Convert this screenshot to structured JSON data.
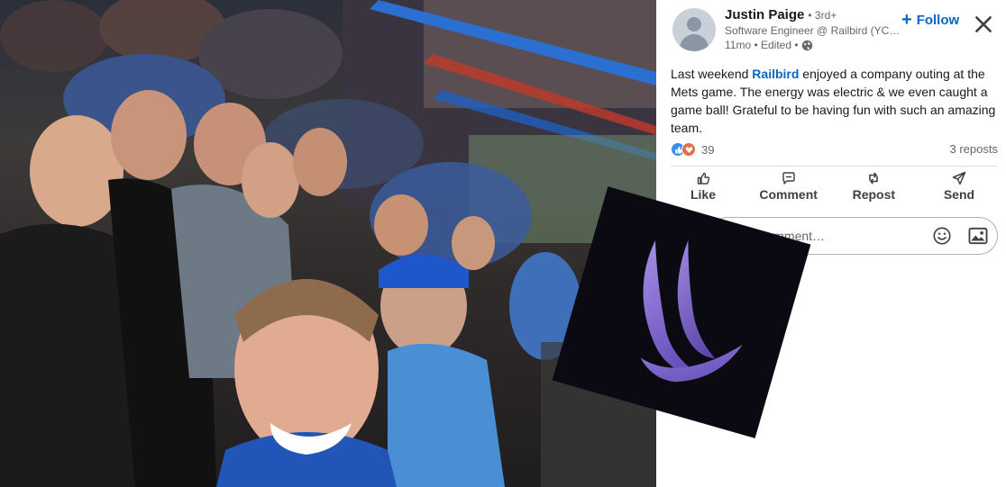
{
  "author": {
    "name": "Justin Paige",
    "degree": "• 3rd+",
    "headline": "Software Engineer @ Railbird (YC…",
    "meta": "11mo • Edited •"
  },
  "follow_label": "Follow",
  "post": {
    "text_before": "Last weekend ",
    "mention": "Railbird",
    "text_after": " enjoyed a company outing at the Mets game. The energy was electric & we even caught a game ball! Grateful to be having fun with such an amazing team."
  },
  "social": {
    "reaction_count": "39",
    "reposts": "3 reposts"
  },
  "actions": [
    {
      "label": "Like",
      "icon": "thumbs-up-icon"
    },
    {
      "label": "Comment",
      "icon": "comment-icon"
    },
    {
      "label": "Repost",
      "icon": "repost-icon"
    },
    {
      "label": "Send",
      "icon": "send-icon"
    }
  ],
  "comment": {
    "placeholder": "Add a comment…"
  },
  "colors": {
    "accent": "#0a66c2",
    "logo_bg": "#0b0a12",
    "logo_mark": "#7b63c9"
  }
}
